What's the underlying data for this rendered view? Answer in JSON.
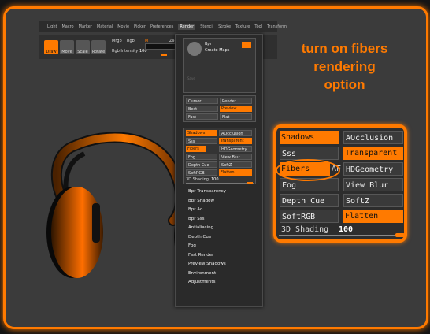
{
  "annotation": {
    "lines": [
      "turn on fibers",
      "rendering",
      "option"
    ]
  },
  "menubar": {
    "items": [
      "Light",
      "Macro",
      "Marker",
      "Material",
      "Movie",
      "Picker",
      "Preferences",
      "Render",
      "Stencil",
      "Stroke",
      "Texture",
      "Tool",
      "Transform"
    ]
  },
  "toolbar": {
    "draw": "Draw",
    "move": "Move",
    "scale": "Scale",
    "rotate": "Rotate",
    "mrgb": "Mrgb",
    "rgb": "Rgb",
    "m": "M",
    "zadd": "Zadd",
    "rgb_intensity_label": "Rgb Intensity",
    "rgb_intensity_value": "100"
  },
  "render_panel": {
    "top_labels": [
      "Bpr",
      "Create Maps",
      "Save"
    ],
    "cursor": "Cursor",
    "render": "Render",
    "best": "Best",
    "preview": "Preview",
    "fast": "Fast",
    "flat": "Flat",
    "options": [
      {
        "label": "Shadows",
        "on": true
      },
      {
        "label": "AOcclusion",
        "on": false
      },
      {
        "label": "Sss",
        "on": false
      },
      {
        "label": "Transparent",
        "on": true
      },
      {
        "label": "Fibers",
        "on": true
      },
      {
        "label": "HDGeometry",
        "on": false
      },
      {
        "label": "Fog",
        "on": false
      },
      {
        "label": "View Blur",
        "on": false
      },
      {
        "label": "Depth Cue",
        "on": false
      },
      {
        "label": "SoftZ",
        "on": false
      },
      {
        "label": "SoftRGB",
        "on": false
      },
      {
        "label": "Flatten",
        "on": true
      }
    ],
    "shading_label": "3D Shading",
    "shading_value": "100",
    "submenu": [
      "Bpr Transparency",
      "Bpr Shadow",
      "Bpr Ao",
      "Bpr Sss",
      "Antialiasing",
      "Depth Cue",
      "Fog",
      "Fast Render",
      "Preview Shadows",
      "Environment",
      "Adjustments"
    ]
  },
  "zoomed_panel": {
    "options": [
      {
        "label": "Shadows",
        "on": true
      },
      {
        "label": "AOcclusion",
        "on": false
      },
      {
        "label": "Sss",
        "on": false
      },
      {
        "label": "Transparent",
        "on": true
      },
      {
        "label": "Fibers",
        "on": true
      },
      {
        "label": "AF",
        "on": false
      },
      {
        "label": "HDGeometry",
        "on": false
      },
      {
        "label": "Fog",
        "on": false
      },
      {
        "label": "View Blur",
        "on": false
      },
      {
        "label": "Depth Cue",
        "on": false
      },
      {
        "label": "SoftZ",
        "on": false
      },
      {
        "label": "SoftRGB",
        "on": false
      },
      {
        "label": "Flatten",
        "on": true
      }
    ],
    "shading_label": "3D Shading",
    "shading_value": "100"
  },
  "colors": {
    "accent": "#ff7a00",
    "frame": "#ff7a00",
    "background": "#3b3b3b"
  }
}
